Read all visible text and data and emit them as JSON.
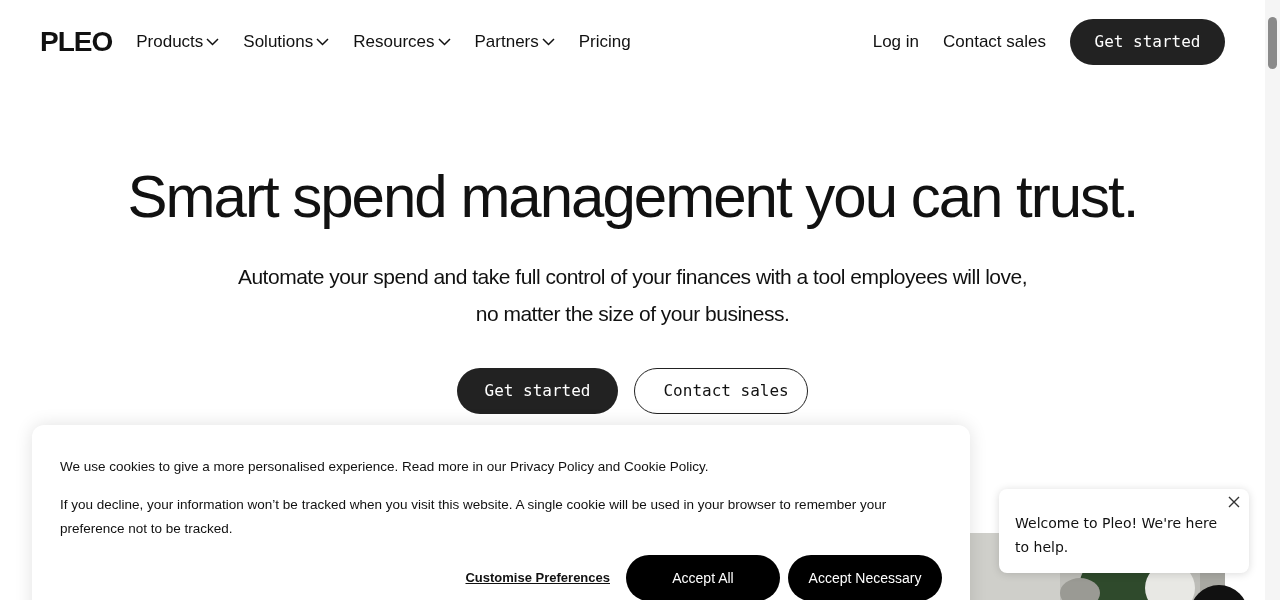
{
  "header": {
    "logo": "PLEO",
    "nav": [
      {
        "label": "Products",
        "dropdown": true
      },
      {
        "label": "Solutions",
        "dropdown": true
      },
      {
        "label": "Resources",
        "dropdown": true
      },
      {
        "label": "Partners",
        "dropdown": true
      },
      {
        "label": "Pricing",
        "dropdown": false
      }
    ],
    "login": "Log in",
    "contact": "Contact sales",
    "cta": "Get started"
  },
  "hero": {
    "title": "Smart spend management you can trust.",
    "subtitle": "Automate your spend and take full control of your finances with a tool employees will love, no matter the size of your business.",
    "primary": "Get started",
    "secondary": "Contact sales"
  },
  "cookie_banner": {
    "paragraphs": [
      "We use cookies to give a more personalised experience. Read more in our Privacy Policy and Cookie Policy.",
      "If you decline, your information won’t be tracked when you visit this website. A single cookie will be used in your browser to remember your preference not to be tracked."
    ],
    "customise": "Customise Preferences",
    "buttons": [
      "Accept All",
      "Accept Necessary"
    ]
  },
  "chat": {
    "message": "Welcome to Pleo! We're here to help."
  }
}
